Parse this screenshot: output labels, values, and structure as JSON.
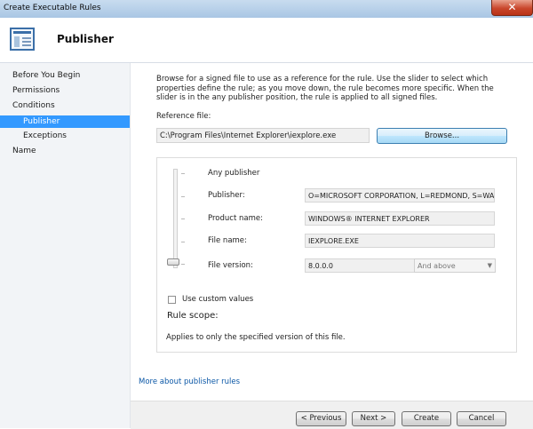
{
  "window": {
    "title": "Create Executable Rules",
    "close_label": "✕"
  },
  "header": {
    "title": "Publisher",
    "icon": "rule-list-icon"
  },
  "nav": {
    "items": [
      {
        "label": "Before You Begin"
      },
      {
        "label": "Permissions"
      },
      {
        "label": "Conditions"
      },
      {
        "label": "Publisher",
        "selected": true
      },
      {
        "label": "Exceptions"
      },
      {
        "label": "Name"
      }
    ]
  },
  "main": {
    "description": "Browse for a signed file to use as a reference for the rule. Use the slider to select which properties define the rule; as you move down, the rule becomes more specific. When the slider is in the any publisher position, the rule is applied to all signed files.",
    "reference_label": "Reference file:",
    "reference_value": "C:\\Program Files\\Internet Explorer\\iexplore.exe",
    "browse_label": "Browse...",
    "levels": {
      "any_publisher": "Any publisher",
      "publisher_label": "Publisher:",
      "publisher_value": "O=MICROSOFT CORPORATION, L=REDMOND, S=WASHINGTON, C=US",
      "product_label": "Product name:",
      "product_value": "WINDOWS® INTERNET EXPLORER",
      "file_label": "File name:",
      "file_value": "IEXPLORE.EXE",
      "version_label": "File version:",
      "version_value": "8.0.0.0",
      "version_option": "And above"
    },
    "custom_values_label": "Use custom values",
    "custom_values_checked": false,
    "rule_scope_label": "Rule scope:",
    "scope_text": "Applies to only the specified version of this file.",
    "more_link": "More about publisher rules"
  },
  "footer": {
    "previous": "< Previous",
    "next": "Next >",
    "create": "Create",
    "cancel": "Cancel"
  }
}
